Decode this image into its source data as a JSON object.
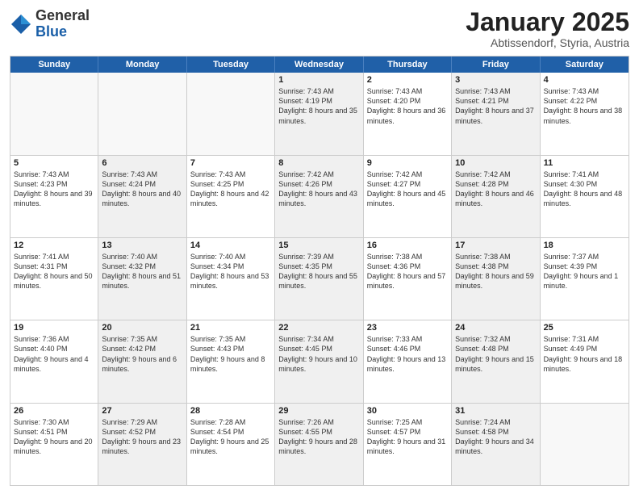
{
  "header": {
    "logo_general": "General",
    "logo_blue": "Blue",
    "month": "January 2025",
    "location": "Abtissendorf, Styria, Austria"
  },
  "days_of_week": [
    "Sunday",
    "Monday",
    "Tuesday",
    "Wednesday",
    "Thursday",
    "Friday",
    "Saturday"
  ],
  "rows": [
    [
      {
        "day": "",
        "text": "",
        "empty": true
      },
      {
        "day": "",
        "text": "",
        "empty": true
      },
      {
        "day": "",
        "text": "",
        "empty": true
      },
      {
        "day": "1",
        "text": "Sunrise: 7:43 AM\nSunset: 4:19 PM\nDaylight: 8 hours and 35 minutes.",
        "shaded": true
      },
      {
        "day": "2",
        "text": "Sunrise: 7:43 AM\nSunset: 4:20 PM\nDaylight: 8 hours and 36 minutes.",
        "shaded": false
      },
      {
        "day": "3",
        "text": "Sunrise: 7:43 AM\nSunset: 4:21 PM\nDaylight: 8 hours and 37 minutes.",
        "shaded": true
      },
      {
        "day": "4",
        "text": "Sunrise: 7:43 AM\nSunset: 4:22 PM\nDaylight: 8 hours and 38 minutes.",
        "shaded": false
      }
    ],
    [
      {
        "day": "5",
        "text": "Sunrise: 7:43 AM\nSunset: 4:23 PM\nDaylight: 8 hours and 39 minutes.",
        "shaded": false
      },
      {
        "day": "6",
        "text": "Sunrise: 7:43 AM\nSunset: 4:24 PM\nDaylight: 8 hours and 40 minutes.",
        "shaded": true
      },
      {
        "day": "7",
        "text": "Sunrise: 7:43 AM\nSunset: 4:25 PM\nDaylight: 8 hours and 42 minutes.",
        "shaded": false
      },
      {
        "day": "8",
        "text": "Sunrise: 7:42 AM\nSunset: 4:26 PM\nDaylight: 8 hours and 43 minutes.",
        "shaded": true
      },
      {
        "day": "9",
        "text": "Sunrise: 7:42 AM\nSunset: 4:27 PM\nDaylight: 8 hours and 45 minutes.",
        "shaded": false
      },
      {
        "day": "10",
        "text": "Sunrise: 7:42 AM\nSunset: 4:28 PM\nDaylight: 8 hours and 46 minutes.",
        "shaded": true
      },
      {
        "day": "11",
        "text": "Sunrise: 7:41 AM\nSunset: 4:30 PM\nDaylight: 8 hours and 48 minutes.",
        "shaded": false
      }
    ],
    [
      {
        "day": "12",
        "text": "Sunrise: 7:41 AM\nSunset: 4:31 PM\nDaylight: 8 hours and 50 minutes.",
        "shaded": false
      },
      {
        "day": "13",
        "text": "Sunrise: 7:40 AM\nSunset: 4:32 PM\nDaylight: 8 hours and 51 minutes.",
        "shaded": true
      },
      {
        "day": "14",
        "text": "Sunrise: 7:40 AM\nSunset: 4:34 PM\nDaylight: 8 hours and 53 minutes.",
        "shaded": false
      },
      {
        "day": "15",
        "text": "Sunrise: 7:39 AM\nSunset: 4:35 PM\nDaylight: 8 hours and 55 minutes.",
        "shaded": true
      },
      {
        "day": "16",
        "text": "Sunrise: 7:38 AM\nSunset: 4:36 PM\nDaylight: 8 hours and 57 minutes.",
        "shaded": false
      },
      {
        "day": "17",
        "text": "Sunrise: 7:38 AM\nSunset: 4:38 PM\nDaylight: 8 hours and 59 minutes.",
        "shaded": true
      },
      {
        "day": "18",
        "text": "Sunrise: 7:37 AM\nSunset: 4:39 PM\nDaylight: 9 hours and 1 minute.",
        "shaded": false
      }
    ],
    [
      {
        "day": "19",
        "text": "Sunrise: 7:36 AM\nSunset: 4:40 PM\nDaylight: 9 hours and 4 minutes.",
        "shaded": false
      },
      {
        "day": "20",
        "text": "Sunrise: 7:35 AM\nSunset: 4:42 PM\nDaylight: 9 hours and 6 minutes.",
        "shaded": true
      },
      {
        "day": "21",
        "text": "Sunrise: 7:35 AM\nSunset: 4:43 PM\nDaylight: 9 hours and 8 minutes.",
        "shaded": false
      },
      {
        "day": "22",
        "text": "Sunrise: 7:34 AM\nSunset: 4:45 PM\nDaylight: 9 hours and 10 minutes.",
        "shaded": true
      },
      {
        "day": "23",
        "text": "Sunrise: 7:33 AM\nSunset: 4:46 PM\nDaylight: 9 hours and 13 minutes.",
        "shaded": false
      },
      {
        "day": "24",
        "text": "Sunrise: 7:32 AM\nSunset: 4:48 PM\nDaylight: 9 hours and 15 minutes.",
        "shaded": true
      },
      {
        "day": "25",
        "text": "Sunrise: 7:31 AM\nSunset: 4:49 PM\nDaylight: 9 hours and 18 minutes.",
        "shaded": false
      }
    ],
    [
      {
        "day": "26",
        "text": "Sunrise: 7:30 AM\nSunset: 4:51 PM\nDaylight: 9 hours and 20 minutes.",
        "shaded": false
      },
      {
        "day": "27",
        "text": "Sunrise: 7:29 AM\nSunset: 4:52 PM\nDaylight: 9 hours and 23 minutes.",
        "shaded": true
      },
      {
        "day": "28",
        "text": "Sunrise: 7:28 AM\nSunset: 4:54 PM\nDaylight: 9 hours and 25 minutes.",
        "shaded": false
      },
      {
        "day": "29",
        "text": "Sunrise: 7:26 AM\nSunset: 4:55 PM\nDaylight: 9 hours and 28 minutes.",
        "shaded": true
      },
      {
        "day": "30",
        "text": "Sunrise: 7:25 AM\nSunset: 4:57 PM\nDaylight: 9 hours and 31 minutes.",
        "shaded": false
      },
      {
        "day": "31",
        "text": "Sunrise: 7:24 AM\nSunset: 4:58 PM\nDaylight: 9 hours and 34 minutes.",
        "shaded": true
      },
      {
        "day": "",
        "text": "",
        "empty": true
      }
    ]
  ]
}
